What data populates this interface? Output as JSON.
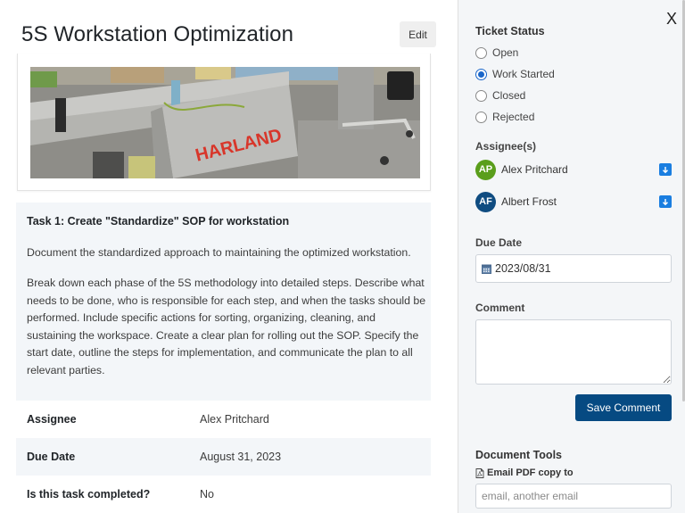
{
  "page": {
    "title": "5S Workstation Optimization",
    "edit_label": "Edit",
    "image_alt": "Harland labeling machine workstation",
    "image_text": "HARLAND"
  },
  "task": {
    "title": "Task 1: Create \"Standardize\" SOP for workstation",
    "summary": "Document the standardized approach to maintaining the optimized workstation.",
    "description": "Break down each phase of the 5S methodology into detailed steps. Describe what needs to be done, who is responsible for each step, and when the tasks should be performed. Include specific actions for sorting, organizing, cleaning, and sustaining the workspace. Create a clear plan for rolling out the SOP. Specify the start date, outline the steps for implementation, and communicate the plan to all relevant parties."
  },
  "details": [
    {
      "label": "Assignee",
      "value": "Alex Pritchard"
    },
    {
      "label": "Due Date",
      "value": "August 31, 2023"
    },
    {
      "label": "Is this task completed?",
      "value": "No"
    }
  ],
  "sidebar": {
    "close_label": "X",
    "status_heading": "Ticket Status",
    "statuses": [
      {
        "label": "Open",
        "checked": false
      },
      {
        "label": "Work Started",
        "checked": true
      },
      {
        "label": "Closed",
        "checked": false
      },
      {
        "label": "Rejected",
        "checked": false
      }
    ],
    "assignees_heading": "Assignee(s)",
    "assignees": [
      {
        "initials": "AP",
        "name": "Alex Pritchard",
        "color": "#5a9e1b"
      },
      {
        "initials": "AF",
        "name": "Albert Frost",
        "color": "#0f4c81"
      }
    ],
    "due_heading": "Due Date",
    "due_value": "2023/08/31",
    "comment_heading": "Comment",
    "comment_value": "",
    "save_label": "Save Comment",
    "doc_tools_heading": "Document Tools",
    "email_pdf_label": "Email PDF copy to",
    "email_placeholder": "email, another email"
  },
  "colors": {
    "primary_button": "#064a82",
    "accent_blue": "#1a66c9",
    "panel_bg": "#f4f6f8"
  }
}
